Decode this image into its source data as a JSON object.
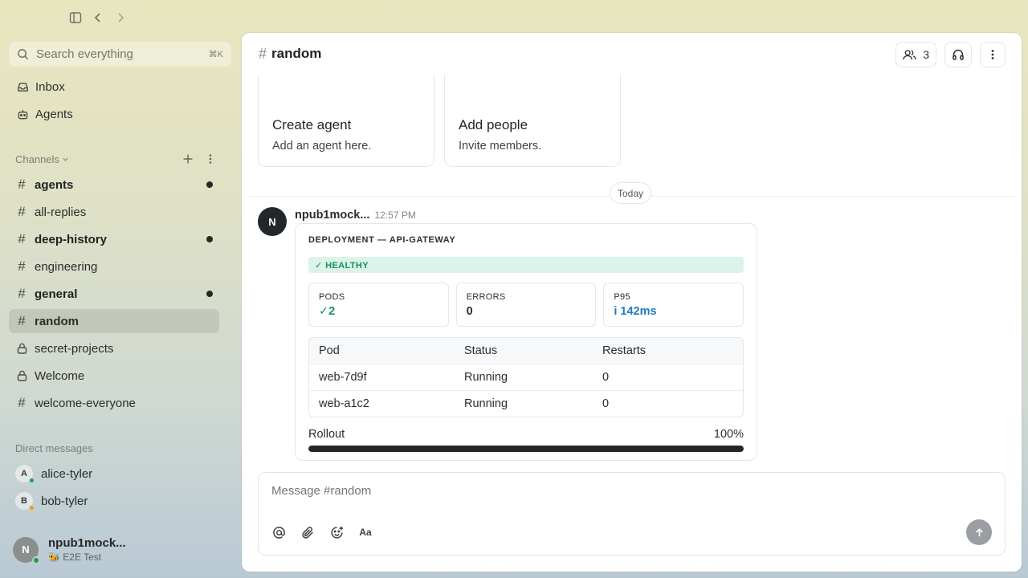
{
  "search": {
    "placeholder": "Search everything",
    "shortcut": "⌘K"
  },
  "nav": [
    {
      "label": "Inbox",
      "icon": "inbox-icon"
    },
    {
      "label": "Agents",
      "icon": "bot-icon"
    }
  ],
  "channels_section": {
    "label": "Channels"
  },
  "channels": [
    {
      "name": "agents",
      "unread": true,
      "private": false
    },
    {
      "name": "all-replies",
      "unread": false,
      "private": false
    },
    {
      "name": "deep-history",
      "unread": true,
      "private": false
    },
    {
      "name": "engineering",
      "unread": false,
      "private": false
    },
    {
      "name": "general",
      "unread": true,
      "private": false
    },
    {
      "name": "random",
      "unread": false,
      "private": false,
      "active": true
    },
    {
      "name": "secret-projects",
      "unread": false,
      "private": true
    },
    {
      "name": "Welcome",
      "unread": false,
      "private": true
    },
    {
      "name": "welcome-everyone",
      "unread": false,
      "private": false
    }
  ],
  "dm_section": {
    "label": "Direct messages"
  },
  "dms": [
    {
      "initial": "A",
      "name": "alice-tyler",
      "status_color": "#16a34a"
    },
    {
      "initial": "B",
      "name": "bob-tyler",
      "status_color": "#f59e0b"
    }
  ],
  "current_user": {
    "initial": "N",
    "name": "npub1mock...",
    "status": "🐝 E2E Test"
  },
  "channel_header": {
    "title": "random",
    "member_count": "3"
  },
  "cards": [
    {
      "title": "Create agent",
      "desc": "Add an agent here."
    },
    {
      "title": "Add people",
      "desc": "Invite members."
    }
  ],
  "date_divider": "Today",
  "message": {
    "author_initial": "N",
    "author": "npub1mock...",
    "time": "12:57 PM",
    "card": {
      "heading": "DEPLOYMENT — API-GATEWAY",
      "status": "✓ HEALTHY",
      "metrics": [
        {
          "label": "PODS",
          "value": "✓2",
          "tone": "ok"
        },
        {
          "label": "ERRORS",
          "value": "0",
          "tone": "neutral"
        },
        {
          "label": "P95",
          "value": "i 142ms",
          "tone": "info"
        }
      ],
      "table": {
        "headers": [
          "Pod",
          "Status",
          "Restarts"
        ],
        "rows": [
          [
            "web-7d9f",
            "Running",
            "0"
          ],
          [
            "web-a1c2",
            "Running",
            "0"
          ]
        ]
      },
      "rollout_label": "Rollout",
      "rollout_text": "100%",
      "rollout_fraction": 1.0
    }
  },
  "composer": {
    "placeholder": "Message #random",
    "format_label": "Aa"
  },
  "colors": {
    "accent_green": "#15915e",
    "info_blue": "#1f7ac7",
    "unread_dot": "#262826"
  }
}
